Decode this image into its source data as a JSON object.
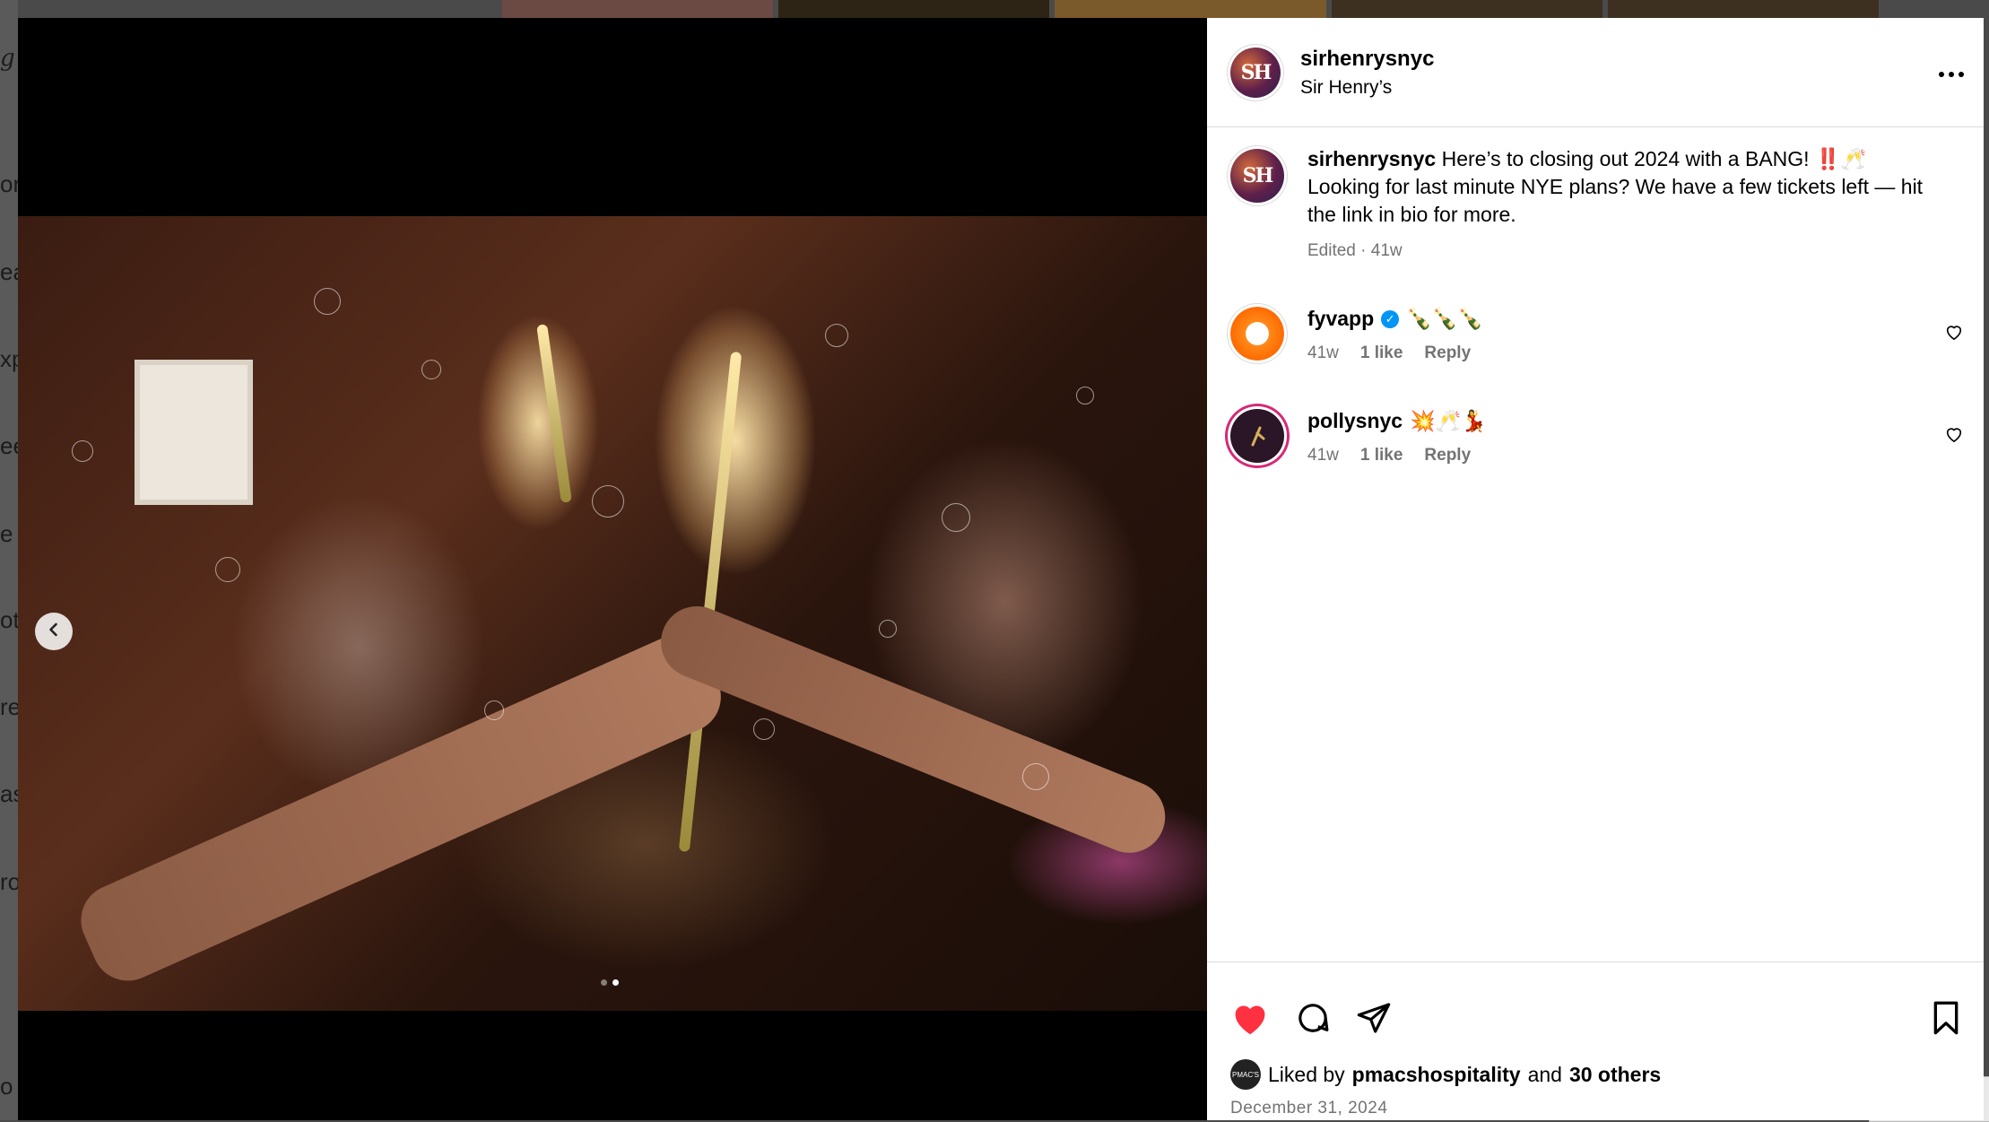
{
  "background": {
    "fragments": [
      "g",
      "or",
      "ea",
      "xp",
      "ee",
      "e",
      "ot",
      "re",
      "as",
      "ro",
      "o"
    ]
  },
  "post": {
    "username": "sirhenrysnyc",
    "display_name": "Sir Henry’s",
    "avatar_text": "SH",
    "caption": "Here’s to closing out 2024 with a BANG! ‼️🥂 Looking for last minute NYE plans? We have a few tickets left — hit the link in bio for more.",
    "caption_meta": "Edited · 41w",
    "liked_by_prefix": "Liked by",
    "liked_by_user": "pmacshospitality",
    "liked_by_and": "and",
    "liked_by_others": "30 others",
    "liked_by_avatar_text": "PMAC'S",
    "date": "December 31, 2024",
    "like_color": "#ff3040"
  },
  "comments": [
    {
      "username": "fyvapp",
      "verified": true,
      "text": "🍾🍾🍾",
      "age": "41w",
      "likes": "1 like",
      "reply": "Reply"
    },
    {
      "username": "pollysnyc",
      "verified": false,
      "text": "💥🥂💃",
      "age": "41w",
      "likes": "1 like",
      "reply": "Reply"
    }
  ],
  "media": {
    "slide_count": 2,
    "active_slide": 2
  }
}
